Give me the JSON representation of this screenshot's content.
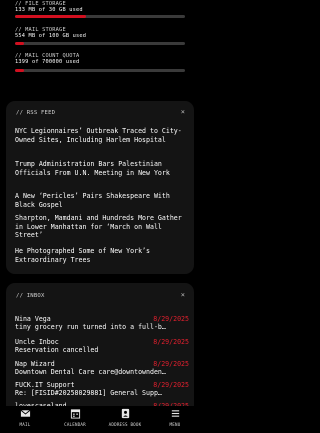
{
  "storage": [
    {
      "label": "// FILE STORAGE",
      "value": "133 MB of 30 GB used",
      "fill": 0.42
    },
    {
      "label": "// MAIL STORAGE",
      "value": "554 MB of 100 GB used",
      "fill": 0.055
    },
    {
      "label": "// MAIL COUNT QUOTA",
      "value": "1399 of 700000 used",
      "fill": 0.055
    }
  ],
  "rss": {
    "title": "// RSS FEED",
    "close_icon": "×",
    "items": [
      "NYC Legionnaires’ Outbreak Traced to City-Owned Sites, Including Harlem Hospital",
      "Trump Administration Bars Palestinian Officials From U.N. Meeting in New York",
      "A New ‘Pericles’ Pairs Shakespeare With Black Gospel",
      "Sharpton, Mamdani and Hundreds More Gather in Lower Manhattan for ‘March on Wall Street’",
      "He Photographed Some of New York’s Extraordinary Trees"
    ]
  },
  "inbox": {
    "title": "// INBOX",
    "close_icon": "×",
    "messages": [
      {
        "from": "Nina Vega",
        "date": "8/29/2025",
        "subject": "tiny grocery run turned into a full-b…"
      },
      {
        "from": "Uncle Inboc",
        "date": "8/29/2025",
        "subject": "Reservation cancelled"
      },
      {
        "from": "Nap Wizard",
        "date": "8/29/2025",
        "subject": "Downtown Dental Care care@downtownden…"
      },
      {
        "from": "FUCK.IT Support",
        "date": "8/29/2025",
        "subject": "Re: [FISID#20258029881] General Supp…"
      },
      {
        "from": "lovescaseland",
        "date": "8/29/2025",
        "subject": ""
      }
    ]
  },
  "nav": [
    {
      "label": "MAIL",
      "icon": "envelope-icon"
    },
    {
      "label": "CALENDAR",
      "icon": "calendar-icon"
    },
    {
      "label": "ADDRESS BOOK",
      "icon": "contact-icon"
    },
    {
      "label": "MENU",
      "icon": "menu-icon"
    }
  ],
  "colors": {
    "accent": "#d20f1f",
    "background": "#000000",
    "panel": "#141414"
  }
}
